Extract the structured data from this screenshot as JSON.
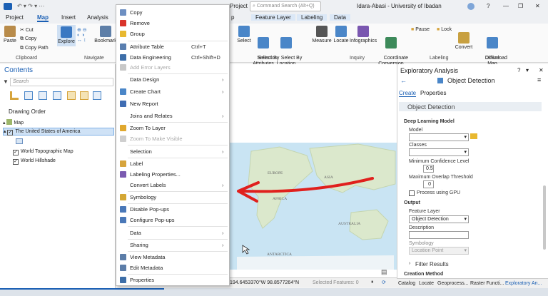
{
  "titlebar": {
    "project": "Project",
    "search_placeholder": "Command Search (Alt+Q)",
    "user": "Idara-Abasi - University of Ibadan",
    "help": "?",
    "minimize": "—",
    "restore": "❐",
    "close": "✕",
    "project_tab": "Project"
  },
  "tabs": {
    "project": "Project",
    "map": "Map",
    "insert": "Insert",
    "analysis": "Analysis",
    "p_fragment": "p",
    "feature_layer": "Feature Layer",
    "labeling": "Labeling",
    "data": "Data"
  },
  "ribbon": {
    "paste": "Paste",
    "cut": "Cut",
    "copy": "Copy",
    "copy_path": "Copy Path",
    "clipboard_group": "Clipboard",
    "explore": "Explore",
    "bookmark": "Bookmark",
    "navigate_group": "Navigate",
    "select": "Select",
    "select_by_attributes": "Select By\nAttributes",
    "select_by_location": "Select By\nLocation",
    "selection_group": "Selection",
    "measure": "Measure",
    "locate": "Locate",
    "infographics": "Infographics",
    "coordinate_conversion": "Coordinate\nConversion",
    "inquiry_group": "Inquiry",
    "pause": "Pause",
    "lock": "Lock",
    "convert": "Convert",
    "labeling_group": "Labeling",
    "download_map": "Download\nMap",
    "offline_group": "Offline"
  },
  "contents": {
    "title": "Contents",
    "search_placeholder": "Search",
    "drawing_order": "Drawing Order",
    "layers": {
      "map": "Map",
      "usa": "The United States of America",
      "topo": "World Topographic Map",
      "hillshade": "World Hillshade"
    }
  },
  "context_menu": [
    {
      "label": "Copy",
      "icon": "copy-icon",
      "color": "#6d8fc2",
      "disabled": false
    },
    {
      "label": "Remove",
      "icon": "remove-icon",
      "color": "#d9342b",
      "disabled": false
    },
    {
      "label": "Group",
      "icon": "group-icon",
      "color": "#e8b830",
      "disabled": false
    },
    {
      "label": "Attribute Table",
      "shortcut": "Ctrl+T",
      "icon": "table-icon",
      "color": "#5a7fb0",
      "disabled": false
    },
    {
      "label": "Data Engineering",
      "shortcut": "Ctrl+Shift+D",
      "icon": "data-engineering-icon",
      "color": "#3d6ea8",
      "disabled": false
    },
    {
      "label": "Add Error Layers",
      "icon": "error-layers-icon",
      "color": "#c8c8c8",
      "disabled": true
    },
    {
      "label": "Data Design",
      "submenu": true,
      "disabled": false
    },
    {
      "label": "Create Chart",
      "submenu": true,
      "icon": "chart-icon",
      "color": "#4a86c8",
      "disabled": false
    },
    {
      "label": "New Report",
      "icon": "report-icon",
      "color": "#3f6db3",
      "disabled": false
    },
    {
      "label": "Joins and Relates",
      "submenu": true,
      "disabled": false
    },
    {
      "label": "Zoom To Layer",
      "icon": "zoom-layer-icon",
      "color": "#e0a82e",
      "disabled": false
    },
    {
      "label": "Zoom To Make Visible",
      "icon": "zoom-visible-icon",
      "color": "#cfcfcf",
      "disabled": true
    },
    {
      "label": "Selection",
      "submenu": true,
      "disabled": false
    },
    {
      "label": "Label",
      "icon": "label-icon",
      "color": "#d6a43c",
      "disabled": false
    },
    {
      "label": "Labeling Properties...",
      "icon": "labeling-properties-icon",
      "color": "#7a5ab0",
      "disabled": false
    },
    {
      "label": "Convert Labels",
      "submenu": true,
      "disabled": false
    },
    {
      "label": "Symbology",
      "icon": "symbology-icon",
      "color": "#d4a735",
      "disabled": false
    },
    {
      "label": "Disable Pop-ups",
      "icon": "popup-disable-icon",
      "color": "#4a78b8",
      "disabled": false
    },
    {
      "label": "Configure Pop-ups",
      "icon": "popup-configure-icon",
      "color": "#4a78b8",
      "disabled": false
    },
    {
      "label": "Data",
      "submenu": true,
      "disabled": false
    },
    {
      "label": "Sharing",
      "submenu": true,
      "disabled": false
    },
    {
      "label": "View Metadata",
      "icon": "metadata-icon",
      "color": "#5c7da8",
      "disabled": false
    },
    {
      "label": "Edit Metadata",
      "icon": "edit-metadata-icon",
      "color": "#5c7da8",
      "disabled": false
    },
    {
      "label": "Properties",
      "icon": "properties-icon",
      "color": "#3d6ea8",
      "disabled": false
    }
  ],
  "map": {
    "labels": {
      "europe": "EUROPE",
      "asia": "ASIA",
      "africa": "AFRICA",
      "australia": "AUSTRALIA",
      "antarctica": "ANTARCTICA"
    },
    "coords": "194.6453370°W 98.8577264°N",
    "selected_features": "Selected Features: 0"
  },
  "geo": {
    "title": "Exploratory Analysis",
    "tool": "Object Detection",
    "tab_create": "Create",
    "tab_properties": "Properties",
    "section": "Object Detection",
    "deep_learning_model": "Deep Learning Model",
    "model": "Model",
    "classes": "Classes",
    "min_conf": "Minimum Confidence Level",
    "min_conf_value": "0.5",
    "max_overlap": "Maximum Overlap Threshold",
    "max_overlap_value": "0",
    "gpu": "Process using GPU",
    "output": "Output",
    "feature_layer": "Feature Layer",
    "feature_layer_value": "Object Detection",
    "description": "Description",
    "symbology": "Symbology",
    "symbology_value": "Location Point",
    "filter_results": "Filter Results",
    "creation_method": "Creation Method",
    "help": "?",
    "pin": "▾",
    "close": "✕",
    "menu": "≡"
  },
  "bottom_tabs": [
    "Catalog",
    "Locate",
    "Geoprocess...",
    "Raster Functi...",
    "Exploratory An..."
  ],
  "colors": {
    "accent": "#1a5fb4",
    "arrow": "#e0201d",
    "ocean": "#c9e4f3",
    "land": "#dbe8cc"
  }
}
